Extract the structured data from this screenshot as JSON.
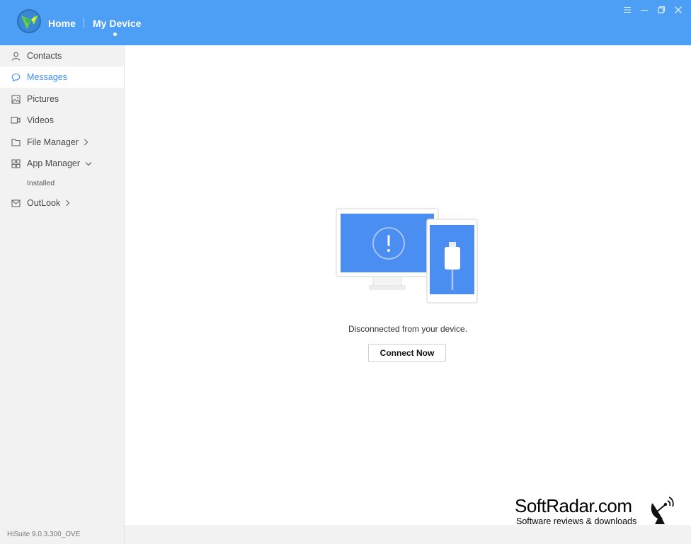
{
  "header": {
    "nav": [
      {
        "label": "Home"
      },
      {
        "label": "My Device"
      }
    ],
    "colors": {
      "background": "#4d9ef5",
      "accent": "#3d8ef0"
    },
    "window_controls": [
      "menu-icon",
      "minimize-icon",
      "restore-icon",
      "close-icon"
    ]
  },
  "sidebar": {
    "items": [
      {
        "label": "Contacts",
        "icon": "person-icon"
      },
      {
        "label": "Messages",
        "icon": "chat-bubble-icon",
        "active": true
      },
      {
        "label": "Pictures",
        "icon": "picture-icon"
      },
      {
        "label": "Videos",
        "icon": "video-icon"
      },
      {
        "label": "File Manager",
        "icon": "folder-icon",
        "chevron": "right"
      },
      {
        "label": "App Manager",
        "icon": "grid-icon",
        "chevron": "down"
      },
      {
        "label": "OutLook",
        "icon": "mail-icon",
        "chevron": "right"
      }
    ],
    "app_manager_sub": [
      {
        "label": "Installed"
      }
    ],
    "version": "HiSuite 9.0.3.300_OVE"
  },
  "main": {
    "status_text": "Disconnected from your device.",
    "connect_button": "Connect Now"
  },
  "watermark": {
    "title": "SoftRadar.com",
    "subtitle": "Software reviews & downloads"
  }
}
